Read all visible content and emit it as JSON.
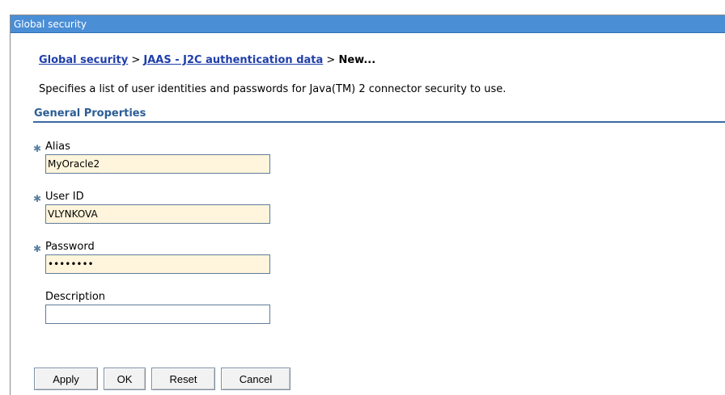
{
  "window": {
    "title": "Global security"
  },
  "breadcrumb": {
    "link1": "Global security",
    "sep1": " > ",
    "link2": "JAAS - J2C authentication data",
    "sep2": " > ",
    "current": "New..."
  },
  "description": "Specifies a list of user identities and passwords for Java(TM) 2 connector security to use.",
  "section_title": "General Properties",
  "fields": {
    "alias": {
      "label": "Alias",
      "value": "MyOracle2",
      "required": true
    },
    "user_id": {
      "label": "User ID",
      "value": "VLYNKOVA",
      "required": true
    },
    "password": {
      "label": "Password",
      "value": "passw0rd",
      "required": true
    },
    "description": {
      "label": "Description",
      "value": "",
      "required": false
    }
  },
  "buttons": {
    "apply": "Apply",
    "ok": "OK",
    "reset": "Reset",
    "cancel": "Cancel"
  },
  "colors": {
    "title_bar": "#4a8ed6",
    "link": "#1f3ea8",
    "section": "#2b5d94",
    "input_bg": "#fff5dc"
  }
}
